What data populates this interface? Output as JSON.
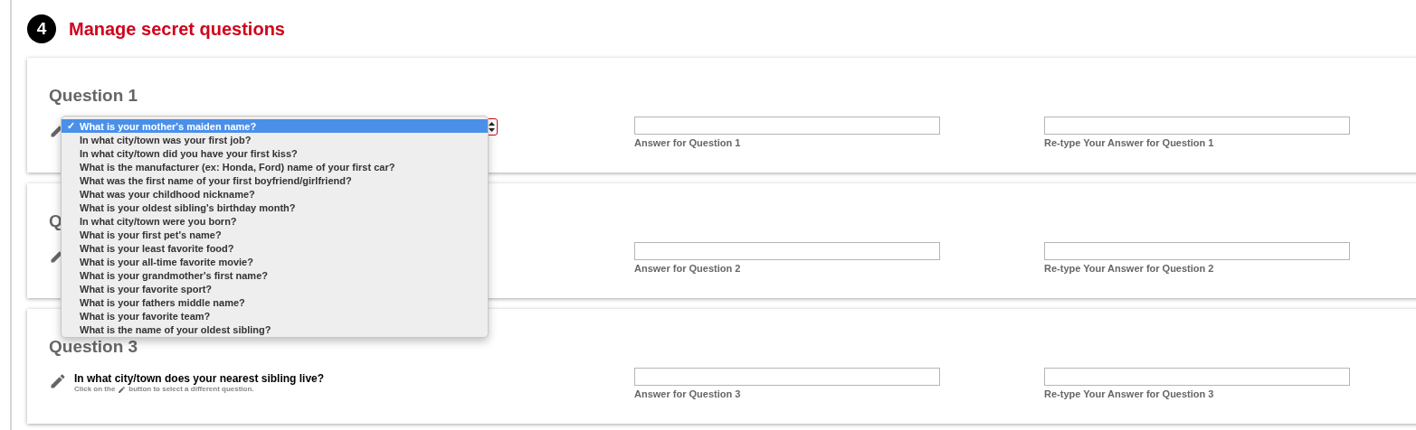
{
  "section": {
    "number": "4",
    "title": "Manage secret questions"
  },
  "questions": [
    {
      "title": "Question 1",
      "editing": true,
      "answer_label": "Answer for Question 1",
      "retype_label": "Re-type Your Answer for Question 1"
    },
    {
      "title": "Q",
      "editing": false,
      "answer_label": "Answer for Question 2",
      "retype_label": "Re-type Your Answer for Question 2"
    },
    {
      "title": "Question 3",
      "editing": false,
      "question": "In what city/town does your nearest sibling live?",
      "hint_before": "Click on the",
      "hint_after": "button to select a different question.",
      "answer_label": "Answer for Question 3",
      "retype_label": "Re-type Your Answer for Question 3"
    }
  ],
  "dropdown": {
    "check": "✓",
    "options": [
      {
        "label": "What is your mother's maiden name?",
        "selected": true
      },
      {
        "label": "In what city/town was your first job?",
        "selected": false
      },
      {
        "label": "In what city/town did you have your first kiss?",
        "selected": false
      },
      {
        "label": "What is the manufacturer (ex: Honda, Ford) name of your first car?",
        "selected": false
      },
      {
        "label": "What was the first name of your first boyfriend/girlfriend?",
        "selected": false
      },
      {
        "label": "What was your childhood nickname?",
        "selected": false
      },
      {
        "label": "What is your oldest sibling's birthday month?",
        "selected": false
      },
      {
        "label": "In what city/town were you born?",
        "selected": false
      },
      {
        "label": "What is your first pet's name?",
        "selected": false
      },
      {
        "label": "What is your least favorite food?",
        "selected": false
      },
      {
        "label": "What is your all-time favorite movie?",
        "selected": false
      },
      {
        "label": "What is your grandmother's first name?",
        "selected": false
      },
      {
        "label": "What is your favorite sport?",
        "selected": false
      },
      {
        "label": "What is your fathers middle name?",
        "selected": false
      },
      {
        "label": "What is your favorite team?",
        "selected": false
      },
      {
        "label": "What is the name of your oldest sibling?",
        "selected": false
      }
    ]
  }
}
